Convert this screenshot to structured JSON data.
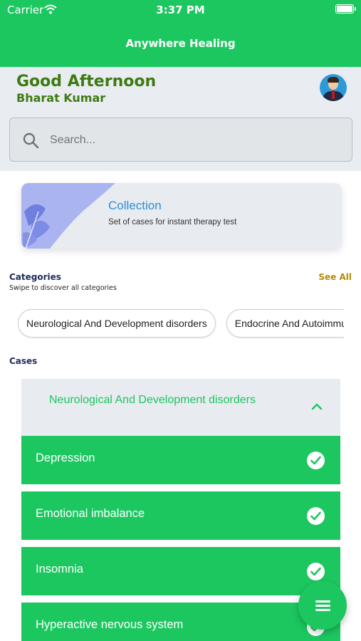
{
  "status_bar": {
    "carrier": "Carrier",
    "time": "3:37 PM"
  },
  "header": {
    "title": "Anywhere Healing"
  },
  "greeting": {
    "text": "Good Afternoon",
    "name": "Bharat Kumar"
  },
  "search": {
    "placeholder": "Search..."
  },
  "collection": {
    "title": "Collection",
    "subtitle": "Set of cases for instant therapy test"
  },
  "categories": {
    "title": "Categories",
    "subtitle": "Swipe to discover all categories",
    "see_all": "See All",
    "chips": [
      "Neurological And Development disorders",
      "Endocrine And Autoimmune disorders"
    ]
  },
  "cases": {
    "title": "Cases",
    "group_title": "Neurological And Development disorders",
    "items": [
      {
        "label": "Depression",
        "checked": true
      },
      {
        "label": "Emotional imbalance",
        "checked": true
      },
      {
        "label": "Insomnia",
        "checked": true
      },
      {
        "label": "Hyperactive nervous system",
        "checked": true
      }
    ]
  },
  "colors": {
    "brand_green": "#1cc760",
    "greeting_green": "#3e7a12",
    "link_blue": "#2d8fd6",
    "see_all_gold": "#b58a00",
    "section_bg": "#e9edf1"
  },
  "icons": [
    "wifi-icon",
    "battery-icon",
    "avatar",
    "search-icon",
    "chevron-up-icon",
    "check-circle-icon",
    "menu-icon"
  ]
}
